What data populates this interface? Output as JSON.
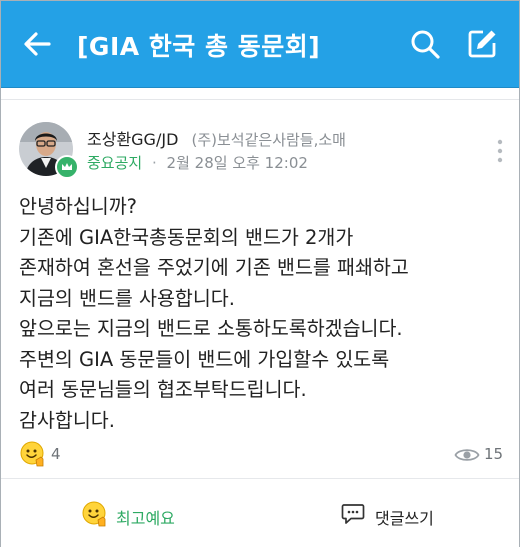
{
  "header": {
    "title": "[GIA 한국 총 동문회]",
    "accent_color": "#24a1e6",
    "back_icon": "back-arrow-icon",
    "search_icon": "search-icon",
    "write_icon": "edit-icon"
  },
  "post": {
    "author": "조상환GG/JD",
    "company": "(주)보석같은사람들,소매",
    "tag": "중요공지",
    "separator": "·",
    "time": "2월 28일 오후 12:02",
    "body_lines": [
      "안녕하십니까?",
      "기존에 GIA한국총동문회의 밴드가 2개가",
      "존재하여 혼선을 주었기에 기존 밴드를 패쇄하고",
      "지금의 밴드를 사용합니다.",
      "앞으로는 지금의 밴드로 소통하도록하겠습니다.",
      "주변의 GIA 동문들이 밴드에 가입할수 있도록",
      "여러 동문님들의 협조부탁드립니다.",
      "감사합니다."
    ],
    "reaction_count": "4",
    "view_count": "15"
  },
  "actions": {
    "like_label": "최고예요",
    "comment_label": "댓글쓰기",
    "like_color": "#2eaa63"
  }
}
